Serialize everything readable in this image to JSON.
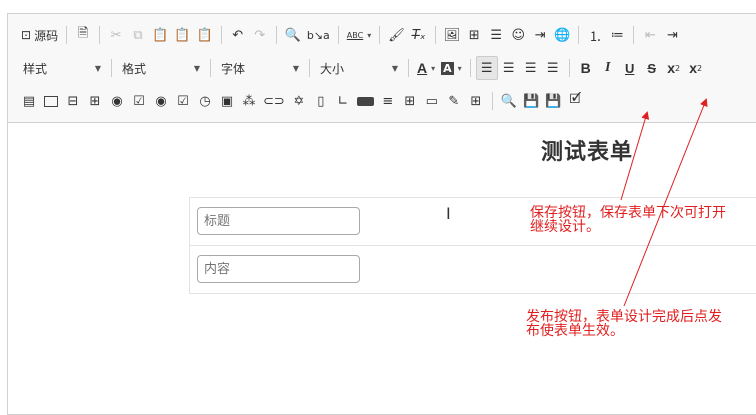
{
  "toolbar": {
    "source_label": "源码",
    "style_combo": "样式",
    "format_combo": "格式",
    "font_combo": "字体",
    "size_combo": "大小",
    "text_color_label": "A",
    "bg_color_label": "A",
    "bold_label": "B",
    "italic_label": "I",
    "underline_label": "U",
    "strike_label": "S",
    "subscript_label": "x",
    "subscript_mark": "2",
    "superscript_label": "x",
    "superscript_mark": "2",
    "spell_label": "ABC"
  },
  "form": {
    "title": "测试表单",
    "fields": [
      {
        "placeholder": "标题"
      },
      {
        "placeholder": "内容"
      }
    ]
  },
  "annotations": {
    "save_note": "保存按钮，保存表单下次可打开\n继续设计。",
    "publish_note": "发布按钮，表单设计完成后点发\n布使表单生效。"
  },
  "colors": {
    "annotation": "#e02020",
    "toolbar_bg": "#f8f8f8",
    "border": "#d1d1d1"
  }
}
